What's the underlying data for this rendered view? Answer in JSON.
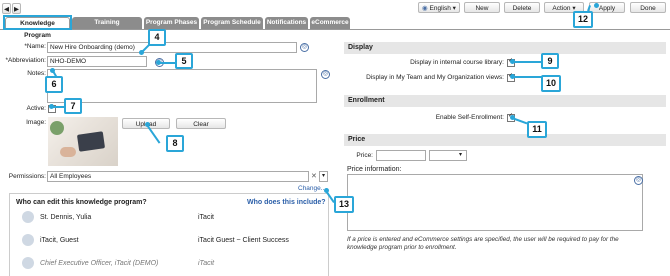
{
  "toolbar": {
    "language": "English",
    "new": "New",
    "delete": "Delete",
    "action": "Action",
    "apply": "Apply",
    "done": "Done"
  },
  "tabs": [
    "Knowledge Program",
    "Training Requirements",
    "Program Phases",
    "Program Schedule",
    "Notifications",
    "eCommerce"
  ],
  "form": {
    "name_label": "*Name:",
    "name_value": "New Hire Onboarding (demo)",
    "abbr_label": "*Abbreviation:",
    "abbr_value": "NHO-DEMO",
    "notes_label": "Notes:",
    "active_label": "Active:",
    "image_label": "Image:",
    "upload": "Upload",
    "clear": "Clear",
    "permissions_label": "Permissions:",
    "permissions_value": "All Employees",
    "change_link": "Change..."
  },
  "editors": {
    "header_left": "Who can edit this knowledge program?",
    "header_right": "Who does this include?",
    "rows": [
      {
        "name": "St. Dennis, Yulia",
        "include": "iTacit"
      },
      {
        "name": "iTacit, Guest",
        "include": "iTacit Guest ~ Client Success"
      },
      {
        "name": "Chief Executive Officer, iTacit (DEMO)",
        "include": "iTacit"
      }
    ]
  },
  "display": {
    "title": "Display",
    "internal_library": "Display in internal course library:",
    "team_views": "Display in My Team and My Organization views:"
  },
  "enrollment": {
    "title": "Enrollment",
    "self_enroll": "Enable Self-Enrollment:"
  },
  "price": {
    "title": "Price",
    "price_label": "Price:",
    "info_label": "Price information:",
    "note": "If a price is entered and eCommerce settings are specified, the user will be required to pay for the knowledge program prior to enrollment."
  },
  "callouts": [
    "4",
    "5",
    "6",
    "7",
    "8",
    "9",
    "10",
    "11",
    "12",
    "13"
  ],
  "colors": {
    "accent": "#2aa6d8",
    "tab_inactive": "#8c8c8c",
    "section_header": "#e6e6e6"
  }
}
